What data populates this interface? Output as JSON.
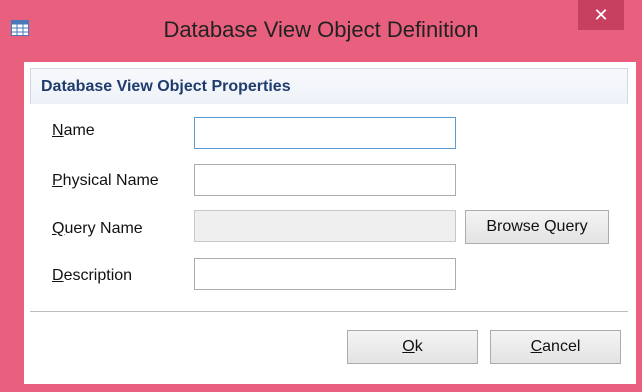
{
  "window": {
    "title": "Database View Object Definition",
    "close_glyph": "✕"
  },
  "group": {
    "title": "Database View Object Properties"
  },
  "fields": {
    "name": {
      "label_mnemonic": "N",
      "label_rest": "ame",
      "value": ""
    },
    "physical_name": {
      "label_mnemonic": "P",
      "label_rest": "hysical Name",
      "value": ""
    },
    "query_name": {
      "label_mnemonic": "Q",
      "label_rest": "uery Name",
      "value": ""
    },
    "description": {
      "label_mnemonic": "D",
      "label_rest": "escription",
      "value": ""
    }
  },
  "buttons": {
    "browse_query": "Browse Query",
    "ok_mnemonic": "O",
    "ok_rest": "k",
    "cancel_mnemonic": "C",
    "cancel_rest": "ancel"
  },
  "colors": {
    "titlebar": "#e9607f",
    "close_button": "#c7405f",
    "group_title": "#1f3c6d"
  },
  "icons": {
    "app_icon": "table-icon",
    "close_icon": "close-icon"
  }
}
